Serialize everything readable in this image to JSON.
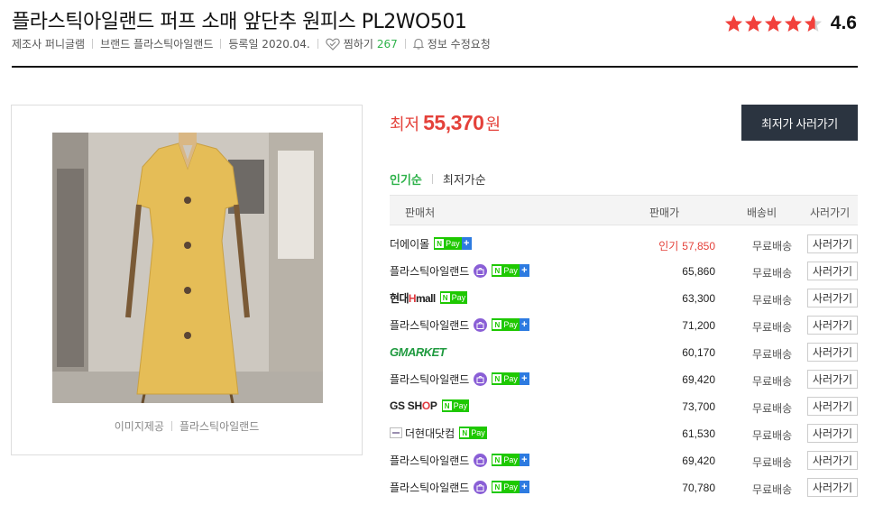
{
  "product": {
    "title": "플라스틱아일랜드 퍼프 소매 앞단추 원피스 PL2WO501",
    "rating": {
      "value": "4.6",
      "stars": 4.6
    }
  },
  "meta": {
    "maker": "제조사 퍼니글램",
    "brand": "브랜드 플라스틱아일랜드",
    "registered": "등록일 2020.04.",
    "zzim_label": "찜하기",
    "zzim_count": "267",
    "report": "정보 수정요청"
  },
  "image": {
    "caption_provider": "이미지제공",
    "caption_source": "플라스틱아일랜드"
  },
  "lowest": {
    "label": "최저",
    "price": "55,370",
    "unit": "원"
  },
  "buy_button": "최저가 사러가기",
  "sort": {
    "active": "인기순",
    "inactive": "최저가순"
  },
  "table": {
    "headers": {
      "seller": "판매처",
      "price": "판매가",
      "shipping": "배송비",
      "buy": "사러가기"
    },
    "rows": [
      {
        "seller": "더에이몰",
        "logo": "text",
        "badge_shop": false,
        "npay": true,
        "npay_plus": true,
        "pop_label": "인기",
        "price": "57,850",
        "shipping": "무료배송",
        "buy": "사러가기"
      },
      {
        "seller": "플라스틱아일랜드",
        "logo": "text",
        "badge_shop": true,
        "npay": true,
        "npay_plus": true,
        "pop_label": "",
        "price": "65,860",
        "shipping": "무료배송",
        "buy": "사러가기"
      },
      {
        "seller": "현대Hmall",
        "logo": "hmall",
        "badge_shop": false,
        "npay": true,
        "npay_plus": false,
        "pop_label": "",
        "price": "63,300",
        "shipping": "무료배송",
        "buy": "사러가기"
      },
      {
        "seller": "플라스틱아일랜드",
        "logo": "text",
        "badge_shop": true,
        "npay": true,
        "npay_plus": true,
        "pop_label": "",
        "price": "71,200",
        "shipping": "무료배송",
        "buy": "사러가기"
      },
      {
        "seller": "GMARKET",
        "logo": "gmarket",
        "badge_shop": false,
        "npay": false,
        "npay_plus": false,
        "pop_label": "",
        "price": "60,170",
        "shipping": "무료배송",
        "buy": "사러가기"
      },
      {
        "seller": "플라스틱아일랜드",
        "logo": "text",
        "badge_shop": true,
        "npay": true,
        "npay_plus": true,
        "pop_label": "",
        "price": "69,420",
        "shipping": "무료배송",
        "buy": "사러가기"
      },
      {
        "seller": "GS SHOP",
        "logo": "gsshop",
        "badge_shop": false,
        "npay": true,
        "npay_plus": false,
        "pop_label": "",
        "price": "73,700",
        "shipping": "무료배송",
        "buy": "사러가기"
      },
      {
        "seller": "더현대닷컴",
        "logo": "thehyundai",
        "badge_shop": false,
        "npay": true,
        "npay_plus": false,
        "pop_label": "",
        "price": "61,530",
        "shipping": "무료배송",
        "buy": "사러가기"
      },
      {
        "seller": "플라스틱아일랜드",
        "logo": "text",
        "badge_shop": true,
        "npay": true,
        "npay_plus": true,
        "pop_label": "",
        "price": "69,420",
        "shipping": "무료배송",
        "buy": "사러가기"
      },
      {
        "seller": "플라스틱아일랜드",
        "logo": "text",
        "badge_shop": true,
        "npay": true,
        "npay_plus": true,
        "pop_label": "",
        "price": "70,780",
        "shipping": "무료배송",
        "buy": "사러가기"
      }
    ]
  },
  "badges": {
    "npay_n": "N",
    "npay_pay": "Pay",
    "npay_plus": "+"
  },
  "colors": {
    "accent_green": "#2eb24a",
    "price_red": "#e4413a",
    "star_red": "#f2403b",
    "button_dark": "#2b3440",
    "npay_green": "#1ec800",
    "npay_plus_blue": "#2d7be0",
    "shop_badge_purple": "#8a5fd6"
  }
}
